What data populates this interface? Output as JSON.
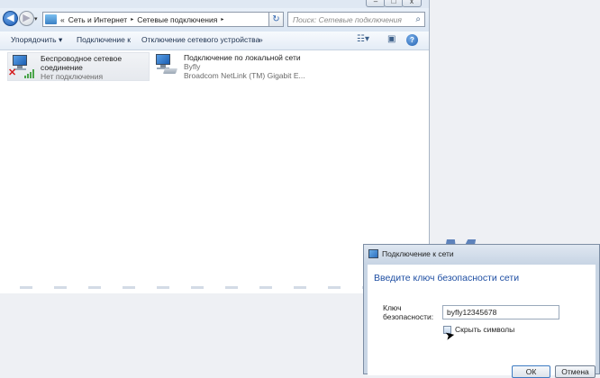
{
  "window": {
    "nav": {
      "history_arrow": "▾",
      "back_icon": "back-arrow-icon",
      "forward_icon": "forward-arrow-icon"
    },
    "address": {
      "prefix": "«",
      "crumbs": [
        "Сеть и Интернет",
        "Сетевые подключения"
      ],
      "separator": "▸"
    },
    "search": {
      "placeholder": "Поиск: Сетевые подключения"
    },
    "toolbar": {
      "organize": "Упорядочить ▾",
      "connect": "Подключение к",
      "disable": "Отключение сетевого устройства",
      "more": "»"
    },
    "items": [
      {
        "title_line1": "Беспроводное сетевое",
        "title_line2": "соединение",
        "status": "Нет подключения"
      },
      {
        "title_line1": "Подключение по локальной сети",
        "network": "Byfly",
        "device": "Broadcom NetLink (TM) Gigabit E..."
      }
    ]
  },
  "dialog": {
    "title": "Подключение к сети",
    "heading": "Введите ключ безопасности сети",
    "key_label_line1": "Ключ",
    "key_label_line2": "безопасности:",
    "key_value": "byfly12345678",
    "hide_chars_label": "Скрыть символы",
    "ok": "ОК",
    "cancel": "Отмена"
  },
  "background": {
    "fragment": "M"
  },
  "colors": {
    "accent": "#1f4fa3",
    "error": "#d51b1b",
    "signal": "#4aa54a"
  }
}
